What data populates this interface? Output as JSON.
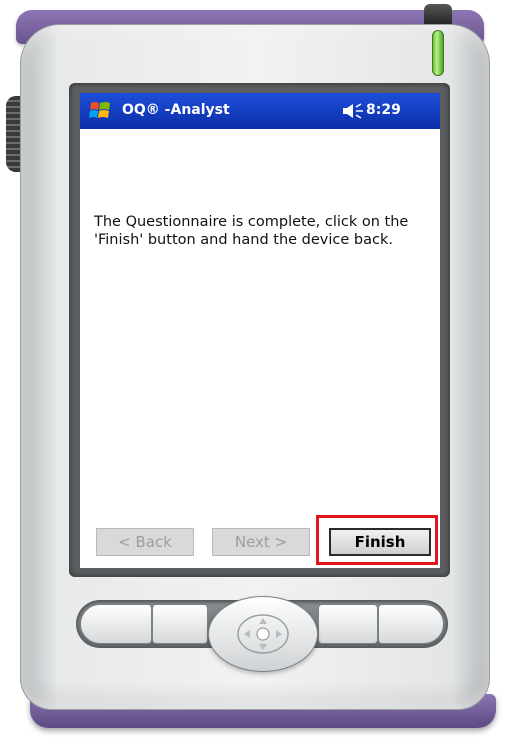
{
  "window": {
    "title": "OQ® -Analyst",
    "time": "8:29"
  },
  "screen": {
    "message": "The Questionnaire is complete, click on the 'Finish' button and hand the device back."
  },
  "wizard": {
    "back_label": "< Back",
    "next_label": "Next >",
    "finish_label": "Finish",
    "back_enabled": false,
    "next_enabled": false,
    "finish_enabled": true
  },
  "icons": {
    "start_menu": "windows-flag-icon",
    "volume": "speaker-icon"
  },
  "colors": {
    "titlebar": "#0b2fa8",
    "highlight_box": "#e0141b",
    "device_trim": "#7a64a0",
    "led": "#6cc23a"
  }
}
